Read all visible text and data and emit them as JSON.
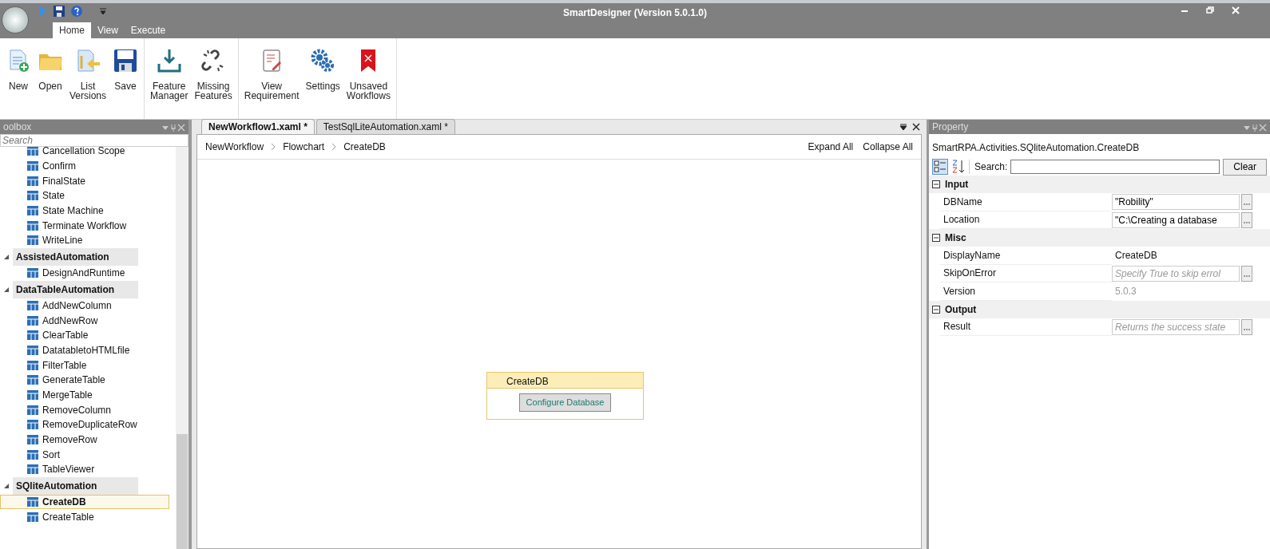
{
  "window": {
    "title": "SmartDesigner (Version 5.0.1.0)"
  },
  "ribbon_tabs": [
    {
      "label": "Home",
      "selected": true
    },
    {
      "label": "View",
      "selected": false
    },
    {
      "label": "Execute",
      "selected": false
    }
  ],
  "ribbon_groups": [
    {
      "buttons": [
        {
          "label": "New"
        },
        {
          "label": "Open"
        },
        {
          "label": "List\nVersions"
        },
        {
          "label": "Save"
        }
      ]
    },
    {
      "buttons": [
        {
          "label": "Feature\nManager"
        },
        {
          "label": "Missing\nFeatures"
        }
      ]
    },
    {
      "buttons": [
        {
          "label": "View\nRequirement"
        },
        {
          "label": "Settings"
        },
        {
          "label": "Unsaved\nWorkflows"
        }
      ]
    }
  ],
  "toolbox": {
    "title": "oolbox",
    "search": {
      "placeholder": "Search"
    },
    "items": [
      {
        "kind": "item",
        "label": "Cancellation Scope",
        "selected": false
      },
      {
        "kind": "item",
        "label": "Confirm",
        "selected": false
      },
      {
        "kind": "item",
        "label": "FinalState",
        "selected": false
      },
      {
        "kind": "item",
        "label": "State",
        "selected": false
      },
      {
        "kind": "item",
        "label": "State Machine",
        "selected": false
      },
      {
        "kind": "item",
        "label": "Terminate Workflow",
        "selected": false
      },
      {
        "kind": "item",
        "label": "WriteLine",
        "selected": false
      },
      {
        "kind": "category",
        "label": "AssistedAutomation",
        "expanded": true
      },
      {
        "kind": "item",
        "label": "DesignAndRuntime",
        "selected": false
      },
      {
        "kind": "category",
        "label": "DataTableAutomation",
        "expanded": true
      },
      {
        "kind": "item",
        "label": "AddNewColumn",
        "selected": false
      },
      {
        "kind": "item",
        "label": "AddNewRow",
        "selected": false
      },
      {
        "kind": "item",
        "label": "ClearTable",
        "selected": false
      },
      {
        "kind": "item",
        "label": "DatatabletoHTMLfile",
        "selected": false
      },
      {
        "kind": "item",
        "label": "FilterTable",
        "selected": false
      },
      {
        "kind": "item",
        "label": "GenerateTable",
        "selected": false
      },
      {
        "kind": "item",
        "label": "MergeTable",
        "selected": false
      },
      {
        "kind": "item",
        "label": "RemoveColumn",
        "selected": false
      },
      {
        "kind": "item",
        "label": "RemoveDuplicateRow",
        "selected": false
      },
      {
        "kind": "item",
        "label": "RemoveRow",
        "selected": false
      },
      {
        "kind": "item",
        "label": "Sort",
        "selected": false
      },
      {
        "kind": "item",
        "label": "TableViewer",
        "selected": false
      },
      {
        "kind": "category",
        "label": "SQliteAutomation",
        "expanded": true
      },
      {
        "kind": "item",
        "label": "CreateDB",
        "selected": true
      },
      {
        "kind": "item",
        "label": "CreateTable",
        "selected": false
      }
    ]
  },
  "documents": {
    "tabs": [
      {
        "label": "NewWorkflow1.xaml *",
        "selected": true
      },
      {
        "label": "TestSqlLiteAutomation.xaml *",
        "selected": false
      }
    ],
    "breadcrumb": [
      "NewWorkflow",
      "Flowchart",
      "CreateDB"
    ],
    "actions": [
      "Expand All",
      "Collapse All"
    ],
    "activity": {
      "title": "CreateDB",
      "button": "Configure Database"
    }
  },
  "property": {
    "title": "Property",
    "type_name": "SmartRPA.Activities.SQliteAutomation.CreateDB",
    "search_label": "Search:",
    "clear_button": "Clear",
    "categories": [
      {
        "label": "Input",
        "expanded": true,
        "rows": [
          {
            "kind": "input",
            "name": "DBName",
            "value": "\"Robility\""
          },
          {
            "kind": "input",
            "name": "Location",
            "value": "\"C:\\Creating a database"
          }
        ]
      },
      {
        "label": "Misc",
        "expanded": true,
        "rows": [
          {
            "kind": "text",
            "name": "DisplayName",
            "value": "CreateDB"
          },
          {
            "kind": "input",
            "name": "SkipOnError",
            "placeholder": "Specify True to skip errol"
          },
          {
            "kind": "readonly",
            "name": "Version",
            "value": "5.0.3"
          }
        ]
      },
      {
        "label": "Output",
        "expanded": true,
        "rows": [
          {
            "kind": "input",
            "name": "Result",
            "placeholder": "Returns the success state"
          }
        ]
      }
    ]
  }
}
